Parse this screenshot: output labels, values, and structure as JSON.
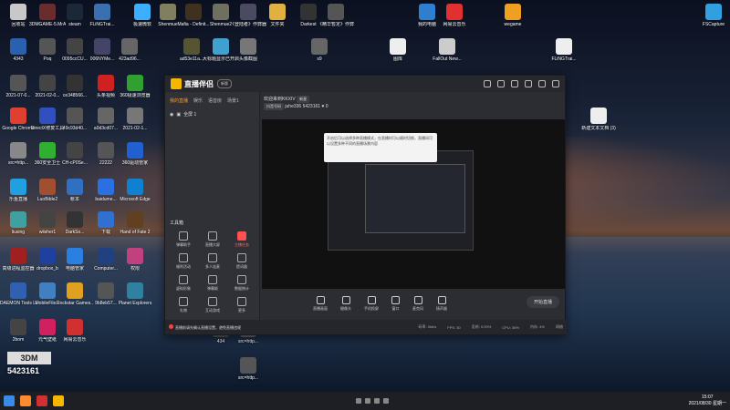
{
  "desktop": {
    "icons": [
      {
        "label": "回收站",
        "color": "#c8c8c8"
      },
      {
        "label": "3DMGAME-5.MrAntiFun",
        "color": "#6a2c2c"
      },
      {
        "label": "steam",
        "color": "#1b2838"
      },
      {
        "label": "FLiNGTrai...",
        "color": "#3a6fb0"
      },
      {
        "label": "极速微软",
        "color": "#3cb0ff"
      },
      {
        "label": "Shenmue",
        "color": "#808060"
      },
      {
        "label": "Mafia - Definit...",
        "color": "#403020"
      },
      {
        "label": "Shenmue2",
        "color": "#707060"
      },
      {
        "label": "《登陆者》作弊器...",
        "color": "#4a4a60"
      },
      {
        "label": "文件夹",
        "color": "#e0b040"
      },
      {
        "label": "Darkest",
        "color": "#333"
      },
      {
        "label": "《精华暂定》作弊...",
        "color": "#555"
      },
      {
        "label": "我的电脑",
        "color": "#2e7fd0"
      },
      {
        "label": "网易云音乐",
        "color": "#e03030"
      },
      {
        "label": "wegame",
        "color": "#f0a020"
      },
      {
        "label": "FSCapture",
        "color": "#30a0e0"
      },
      {
        "label": "4343",
        "color": "#2a60b0"
      },
      {
        "label": "Poq",
        "color": "#555"
      },
      {
        "label": "0095ccCU...",
        "color": "#444"
      },
      {
        "label": "006NYMe...",
        "color": "#446"
      },
      {
        "label": "423ad96...",
        "color": "#666"
      },
      {
        "label": "ad53e11a...",
        "color": "#553"
      },
      {
        "label": "大标题显示已开启...",
        "color": "#40a0d0"
      },
      {
        "label": "头像截图",
        "color": "#777"
      },
      {
        "label": "s9",
        "color": "#666"
      },
      {
        "label": "图库",
        "color": "#eee"
      },
      {
        "label": "FallOut New...",
        "color": "#ccc"
      },
      {
        "label": "FLiNGTrai...",
        "color": "#eee"
      },
      {
        "label": "2021-07-0...",
        "color": "#555"
      },
      {
        "label": "2021-02-0...",
        "color": "#444"
      },
      {
        "label": "ce348566...",
        "color": "#333"
      },
      {
        "label": "头条视频",
        "color": "#d02020"
      },
      {
        "label": "360极速浏览器",
        "color": "#30a030"
      },
      {
        "label": "Google Chrome",
        "color": "#e04030"
      },
      {
        "label": "DirectX修复工具",
        "color": "#3050c0"
      },
      {
        "label": "49c93d40...",
        "color": "#555"
      },
      {
        "label": "a0d3cd07...",
        "color": "#666"
      },
      {
        "label": "2021-02-1...",
        "color": "#777"
      },
      {
        "label": "src=http...",
        "color": "#888"
      },
      {
        "label": "360安全卫士",
        "color": "#30b030"
      },
      {
        "label": "CH-cP0Se...",
        "color": "#444"
      },
      {
        "label": "22222",
        "color": "#555"
      },
      {
        "label": "360驱动管家",
        "color": "#2060d0"
      },
      {
        "label": "乐鱼直播",
        "color": "#20a0e0"
      },
      {
        "label": "LuoBible2",
        "color": "#a05030"
      },
      {
        "label": "帐本",
        "color": "#3070c0"
      },
      {
        "label": "baidume...",
        "color": "#2a70e0"
      },
      {
        "label": "Microsoft Edge",
        "color": "#1080d0"
      },
      {
        "label": "liusing",
        "color": "#40a0a0"
      },
      {
        "label": "wiisher1",
        "color": "#444"
      },
      {
        "label": "DarkSo...",
        "color": "#333"
      },
      {
        "label": "下载",
        "color": "#3070d0"
      },
      {
        "label": "Hand of Fate 2",
        "color": "#604020"
      },
      {
        "label": "高级进程监控器",
        "color": "#a02020"
      },
      {
        "label": "dropbox_b",
        "color": "#2040a0"
      },
      {
        "label": "电脑管家",
        "color": "#2a80e0"
      },
      {
        "label": "Computer...",
        "color": "#204080"
      },
      {
        "label": "权限",
        "color": "#c04080"
      },
      {
        "label": "DAEMON Tools Lite",
        "color": "#3060b0"
      },
      {
        "label": "MobileFile...",
        "color": "#4080c0"
      },
      {
        "label": "Rockstar Games...",
        "color": "#e0a020"
      },
      {
        "label": "9b8eb57...",
        "color": "#555"
      },
      {
        "label": "Planet Explorers",
        "color": "#3080a0"
      },
      {
        "label": "2bom",
        "color": "#444"
      },
      {
        "label": "元气壁纸",
        "color": "#d02060"
      },
      {
        "label": "网易云音乐",
        "color": "#d03030"
      },
      {
        "label": "434",
        "color": "#555"
      },
      {
        "label": "src=http...",
        "color": "#666"
      },
      {
        "label": "src=http...",
        "color": "#555"
      },
      {
        "label": "新建文本文档 (3)",
        "color": "#eee"
      }
    ]
  },
  "app": {
    "name": "直播伴侣",
    "version": "新版",
    "left_tabs": [
      "我的直播",
      "娱乐",
      "语音房",
      "场景1"
    ],
    "scene_item": "全屏 1",
    "tools_title": "工具箱",
    "tools": [
      {
        "label": "弹幕助手",
        "red": false
      },
      {
        "label": "直播大屏",
        "red": false
      },
      {
        "label": "主播任务",
        "red": true
      },
      {
        "label": "福利活动",
        "red": false
      },
      {
        "label": "多人连麦",
        "red": false
      },
      {
        "label": "提词器",
        "red": false
      },
      {
        "label": "虚拟形象",
        "red": false
      },
      {
        "label": "弹幕姬",
        "red": false
      },
      {
        "label": "数据统计",
        "red": false
      },
      {
        "label": "礼物",
        "red": false
      },
      {
        "label": "互动游戏",
        "red": false
      },
      {
        "label": "更多",
        "red": false
      }
    ],
    "room": {
      "welcome": "欢迎来到KKXIV",
      "tag": "新星",
      "follow_btn": "抖音号码",
      "user": "juhe336",
      "id": "5423161",
      "count": "0"
    },
    "tooltip": "开启后可以选择多种直播模式，在直播时可以随时切换，直播间可以设置多种不同的直播场景内容",
    "controls": [
      "直播画面",
      "摄像头",
      "手机投屏",
      "窗口",
      "麦克风",
      "扬声器"
    ],
    "go_live": "开始直播",
    "status": {
      "notice": "直播前请先确认直播设置，避免直播违规",
      "bitrate": "码率: 0kb/s",
      "fps": "FPS: 30",
      "drop": "丢帧: 0.00%",
      "cpu": "CPU: 36%",
      "mem": "内存: 4%",
      "net": "网络"
    }
  },
  "watermark": {
    "logo": "3DM",
    "sub": "5423161"
  },
  "taskbar": {
    "time": "15:07",
    "date": "2021/08/30 星期一"
  }
}
